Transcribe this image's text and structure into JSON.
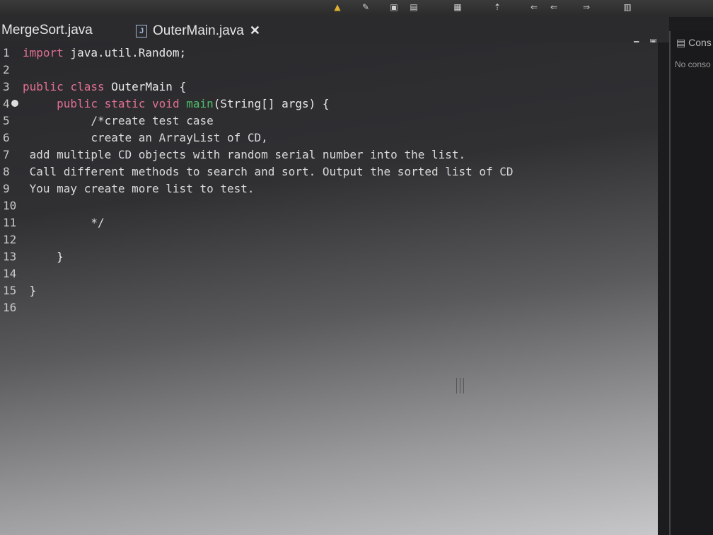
{
  "tabs": [
    {
      "label": "MergeSort.java"
    },
    {
      "label": "OuterMain.java",
      "icon": "J",
      "close": "✕"
    }
  ],
  "console": {
    "title": "Cons",
    "message": "No conso"
  },
  "code": {
    "lines": [
      {
        "n": "1",
        "tokens": [
          {
            "t": "import",
            "c": "kw"
          },
          {
            "t": " java.util.Random;",
            "c": ""
          }
        ]
      },
      {
        "n": "2",
        "tokens": []
      },
      {
        "n": "3",
        "tokens": [
          {
            "t": "public",
            "c": "kw"
          },
          {
            "t": " ",
            "c": ""
          },
          {
            "t": "class",
            "c": "kw"
          },
          {
            "t": " OuterMain {",
            "c": ""
          }
        ]
      },
      {
        "n": "4",
        "tokens": [
          {
            "t": "     public",
            "c": "kw"
          },
          {
            "t": " ",
            "c": ""
          },
          {
            "t": "static",
            "c": "kw"
          },
          {
            "t": " ",
            "c": ""
          },
          {
            "t": "void",
            "c": "kw"
          },
          {
            "t": " ",
            "c": ""
          },
          {
            "t": "main",
            "c": "m"
          },
          {
            "t": "(String[] args) {",
            "c": ""
          }
        ]
      },
      {
        "n": "5",
        "tokens": [
          {
            "t": "          /*create test case",
            "c": "cm"
          }
        ]
      },
      {
        "n": "6",
        "tokens": [
          {
            "t": "          create an ArrayList of CD,",
            "c": "cm"
          }
        ]
      },
      {
        "n": "7",
        "tokens": [
          {
            "t": " add multiple CD objects with random serial number into the list.",
            "c": "cm"
          }
        ]
      },
      {
        "n": "8",
        "tokens": [
          {
            "t": " Call different methods to search and sort. Output the sorted list of CD",
            "c": "cm"
          }
        ]
      },
      {
        "n": "9",
        "tokens": [
          {
            "t": " You may create more list to test.",
            "c": "cm"
          }
        ]
      },
      {
        "n": "10",
        "tokens": []
      },
      {
        "n": "11",
        "tokens": [
          {
            "t": "          */",
            "c": "cm"
          }
        ]
      },
      {
        "n": "12",
        "tokens": []
      },
      {
        "n": "13",
        "tokens": [
          {
            "t": "     }",
            "c": ""
          }
        ]
      },
      {
        "n": "14",
        "tokens": []
      },
      {
        "n": "15",
        "tokens": [
          {
            "t": " }",
            "c": ""
          }
        ]
      },
      {
        "n": "16",
        "tokens": []
      }
    ]
  },
  "toolbar_icons": [
    "run-icon",
    "debug-icon",
    "save-icon",
    "window-icon",
    "pin-icon",
    "back-arrow-icon",
    "forward-arrow-icon",
    "perspective-icon"
  ],
  "colors": {
    "keyword": "#e07090",
    "method": "#4fbf6a",
    "text": "#e8e8e8"
  }
}
